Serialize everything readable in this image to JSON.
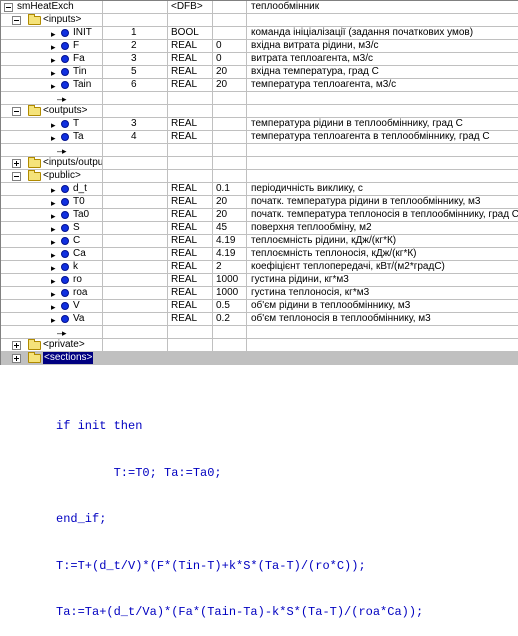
{
  "rows": [
    {
      "level": 0,
      "kind": "root",
      "name": "smHeatExch",
      "idx": "",
      "type": "<DFB>",
      "val": "",
      "cmt": "теплообмінник"
    },
    {
      "level": 1,
      "kind": "folder",
      "open": true,
      "name": "<inputs>",
      "idx": "",
      "type": "",
      "val": "",
      "cmt": ""
    },
    {
      "level": 2,
      "kind": "var",
      "name": "INIT",
      "idx": "1",
      "type": "BOOL",
      "val": "",
      "cmt": "команда ініціалізації (задання початкових умов)"
    },
    {
      "level": 2,
      "kind": "var",
      "name": "F",
      "idx": "2",
      "type": "REAL",
      "val": "0",
      "cmt": "вхідна витрата рідини, м3/с"
    },
    {
      "level": 2,
      "kind": "var",
      "name": "Fa",
      "idx": "3",
      "type": "REAL",
      "val": "0",
      "cmt": "витрата теплоагента, м3/с"
    },
    {
      "level": 2,
      "kind": "var",
      "name": "Tin",
      "idx": "5",
      "type": "REAL",
      "val": "20",
      "cmt": "вхідна температура, град С"
    },
    {
      "level": 2,
      "kind": "var",
      "name": "Tain",
      "idx": "6",
      "type": "REAL",
      "val": "20",
      "cmt": "температура теплоагента, м3/с"
    },
    {
      "level": 2,
      "kind": "arrow",
      "name": "",
      "idx": "",
      "type": "",
      "val": "",
      "cmt": ""
    },
    {
      "level": 1,
      "kind": "folder",
      "open": true,
      "name": "<outputs>",
      "idx": "",
      "type": "",
      "val": "",
      "cmt": ""
    },
    {
      "level": 2,
      "kind": "var",
      "name": "T",
      "idx": "3",
      "type": "REAL",
      "val": "",
      "cmt": "температура рідини в теплообміннику, град С"
    },
    {
      "level": 2,
      "kind": "var",
      "name": "Ta",
      "idx": "4",
      "type": "REAL",
      "val": "",
      "cmt": "температура теплоагента в теплообміннику, град С"
    },
    {
      "level": 2,
      "kind": "arrow",
      "name": "",
      "idx": "",
      "type": "",
      "val": "",
      "cmt": ""
    },
    {
      "level": 1,
      "kind": "folder",
      "open": false,
      "name": "<inputs/outpu...",
      "idx": "",
      "type": "",
      "val": "",
      "cmt": ""
    },
    {
      "level": 1,
      "kind": "folder",
      "open": true,
      "name": "<public>",
      "idx": "",
      "type": "",
      "val": "",
      "cmt": ""
    },
    {
      "level": 2,
      "kind": "var",
      "name": "d_t",
      "idx": "",
      "type": "REAL",
      "val": "0.1",
      "cmt": "періодичність виклику, с"
    },
    {
      "level": 2,
      "kind": "var",
      "name": "T0",
      "idx": "",
      "type": "REAL",
      "val": "20",
      "cmt": "початк. температура рідини в теплообміннику, м3"
    },
    {
      "level": 2,
      "kind": "var",
      "name": "Ta0",
      "idx": "",
      "type": "REAL",
      "val": "20",
      "cmt": "початк. температура теплоносія в теплообміннику, град С"
    },
    {
      "level": 2,
      "kind": "var",
      "name": "S",
      "idx": "",
      "type": "REAL",
      "val": "45",
      "cmt": "поверхня теплообміну, м2"
    },
    {
      "level": 2,
      "kind": "var",
      "name": "C",
      "idx": "",
      "type": "REAL",
      "val": "4.19",
      "cmt": "теплоємність рідини, кДж/(кг*К)"
    },
    {
      "level": 2,
      "kind": "var",
      "name": "Ca",
      "idx": "",
      "type": "REAL",
      "val": "4.19",
      "cmt": "теплоємність теплоносія, кДж/(кг*К)"
    },
    {
      "level": 2,
      "kind": "var",
      "name": "k",
      "idx": "",
      "type": "REAL",
      "val": "2",
      "cmt": "коефіцієнт теплопередачі, кВт/(м2*градС)"
    },
    {
      "level": 2,
      "kind": "var",
      "name": "ro",
      "idx": "",
      "type": "REAL",
      "val": "1000",
      "cmt": "густина рідини, кг*м3"
    },
    {
      "level": 2,
      "kind": "var",
      "name": "roa",
      "idx": "",
      "type": "REAL",
      "val": "1000",
      "cmt": "густина теплоносія, кг*м3"
    },
    {
      "level": 2,
      "kind": "var",
      "name": "V",
      "idx": "",
      "type": "REAL",
      "val": "0.5",
      "cmt": "об'єм рідини в теплообміннику, м3"
    },
    {
      "level": 2,
      "kind": "var",
      "name": "Va",
      "idx": "",
      "type": "REAL",
      "val": "0.2",
      "cmt": "об'єм теплоносія в теплообміннику, м3"
    },
    {
      "level": 2,
      "kind": "arrow",
      "name": "",
      "idx": "",
      "type": "",
      "val": "",
      "cmt": ""
    },
    {
      "level": 1,
      "kind": "folder",
      "open": false,
      "name": "<private>",
      "idx": "",
      "type": "",
      "val": "",
      "cmt": ""
    },
    {
      "level": 1,
      "kind": "folder",
      "open": false,
      "name": "<sections>",
      "idx": "",
      "type": "",
      "val": "",
      "cmt": "",
      "selected": true
    }
  ],
  "code": {
    "l1": "if init then",
    "l2": "        T:=T0; Ta:=Ta0;",
    "l3": "end_if;",
    "l4": "T:=T+(d_t/V)*(F*(Tin-T)+k*S*(Ta-T)/(ro*C));",
    "l5": "Ta:=Ta+(d_t/Va)*(Fa*(Tain-Ta)-k*S*(Ta-T)/(roa*Ca));"
  }
}
